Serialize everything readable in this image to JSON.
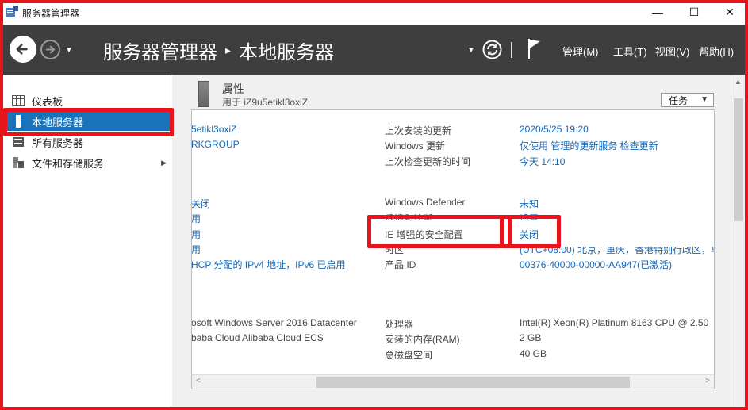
{
  "window": {
    "title": "服务器管理器",
    "minimize": "—",
    "maximize": "☐",
    "close": "✕"
  },
  "header": {
    "breadcrumb_root": "服务器管理器",
    "breadcrumb_sep": "▸",
    "breadcrumb_current": "本地服务器",
    "menus": [
      "管理(M)",
      "工具(T)",
      "视图(V)",
      "帮助(H)"
    ]
  },
  "sidebar": {
    "items": [
      {
        "label": "仪表板",
        "icon": "dashboard-icon"
      },
      {
        "label": "本地服务器",
        "icon": "server-icon",
        "active": true
      },
      {
        "label": "所有服务器",
        "icon": "servers-icon"
      },
      {
        "label": "文件和存储服务",
        "icon": "storage-icon",
        "has_children": true
      }
    ]
  },
  "properties": {
    "title": "属性",
    "subtitle": "用于 iZ9u5etikl3oxiZ",
    "tasks_label": "任务",
    "left_values": [
      "5etikl3oxiZ",
      "RKGROUP",
      "关闭",
      "用",
      "用",
      "用",
      "HCP 分配的 IPv4 地址，IPv6 已启用",
      "osoft Windows Server 2016 Datacenter",
      "baba Cloud Alibaba Cloud ECS"
    ],
    "rows": [
      {
        "label": "上次安装的更新",
        "value": "2020/5/25 19:20"
      },
      {
        "label": "Windows 更新",
        "value": "仅使用 管理的更新服务 检查更新"
      },
      {
        "label": "上次检查更新的时间",
        "value": "今天 14:10"
      },
      {
        "label": "Windows Defender",
        "value": "未知"
      },
      {
        "label": "反馈和诊断",
        "value": "设置"
      },
      {
        "label": "IE 增强的安全配置",
        "value": "关闭"
      },
      {
        "label": "时区",
        "value": "(UTC+08:00) 北京，重庆，香港特别行政区，乌"
      },
      {
        "label": "产品 ID",
        "value": "00376-40000-00000-AA947(已激活)"
      },
      {
        "label": "处理器",
        "value": "Intel(R) Xeon(R) Platinum 8163 CPU @ 2.50"
      },
      {
        "label": "安装的内存(RAM)",
        "value": "2 GB"
      },
      {
        "label": "总磁盘空间",
        "value": "40 GB"
      }
    ]
  },
  "colors": {
    "header_bg": "#3e3e3e",
    "accent": "#1a73b8",
    "link": "#1667b5",
    "highlight": "#e8141c"
  }
}
